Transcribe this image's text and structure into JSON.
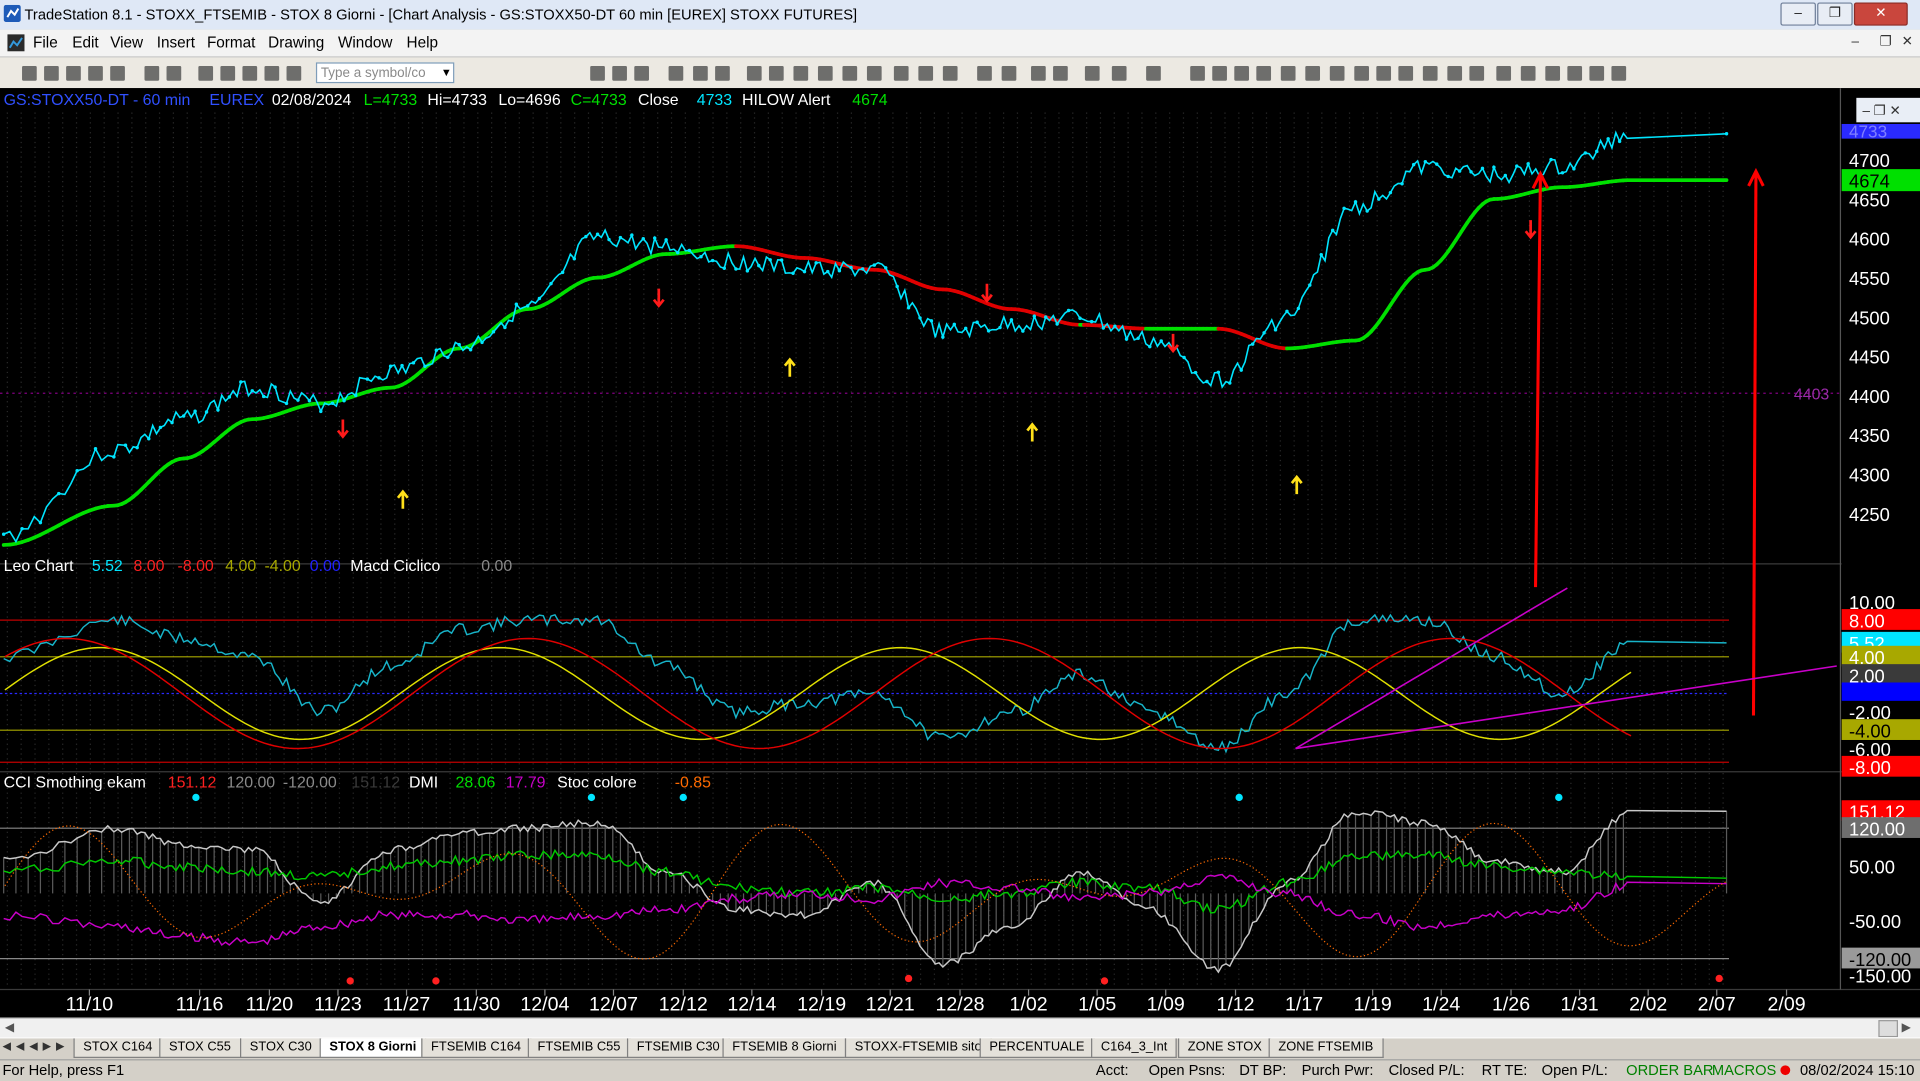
{
  "window": {
    "title": "TradeStation 8.1 - STOXX_FTSEMIB - STOX  8 Giorni - [Chart Analysis - GS:STOXX50-DT  60 min  [EUREX] STOXX FUTURES]"
  },
  "menu": [
    "File",
    "Edit",
    "View",
    "Insert",
    "Format",
    "Drawing",
    "Window",
    "Help"
  ],
  "toolbar": {
    "symbol_placeholder": "Type a symbol/co"
  },
  "price_header": {
    "symbol": "GS:STOXX50-DT - 60 min",
    "exchange": "EUREX",
    "date": "02/08/2024",
    "last": "L=4733",
    "hi": "Hi=4733",
    "lo": "Lo=4696",
    "close_eq": "C=4733",
    "close_label": "Close",
    "close_val": "4733",
    "hilow_label": "HILOW Alert",
    "hilow_val": "4674"
  },
  "leo_header": {
    "title": "Leo Chart",
    "v1": "5.52",
    "v2": "8.00",
    "v3": "-8.00",
    "v4": "4.00",
    "v5": "-4.00",
    "v6": "0.00",
    "macd_label": "Macd Ciclico",
    "macd_val": "0.00"
  },
  "cci_header": {
    "title": "CCI Smothing ekam",
    "v1": "151.12",
    "v2": "120.00",
    "v3": "-120.00",
    "v4": "151.12",
    "dmi_label": "DMI",
    "dmi1": "28.06",
    "dmi2": "17.79",
    "stoc_label": "Stoc colore",
    "stoc_val": "-0.85"
  },
  "axis": {
    "price_ticks": [
      "4700",
      "4650",
      "4600",
      "4550",
      "4500",
      "4450",
      "4400",
      "4350",
      "4300",
      "4250"
    ],
    "price_top_partial": "4733",
    "price_badge": "4674",
    "price_ref_label": "4403",
    "leo_ticks": [
      "10.00",
      "-6.00"
    ],
    "leo_badges": [
      {
        "text": "8.00",
        "bg": "#ff0000",
        "fg": "#ffffff"
      },
      {
        "text": "5.52",
        "bg": "#00e5ff",
        "fg": "#ffffff"
      },
      {
        "text": "4.00",
        "bg": "#a8a800",
        "fg": "#ffffff"
      },
      {
        "text": "2.00",
        "bg": "#3a3a3a",
        "fg": "#ffffff"
      },
      {
        "text": "0.00",
        "bg": "#0000ff",
        "fg": "#0000ff"
      },
      {
        "text": "-2.00",
        "bg": "#000000",
        "fg": "#ffffff"
      },
      {
        "text": "-4.00",
        "bg": "#a8a800",
        "fg": "#000000"
      },
      {
        "text": "-8.00",
        "bg": "#ff0000",
        "fg": "#ffffff"
      }
    ],
    "cci_ticks": [
      "50.00",
      "-50.00",
      "-150.00"
    ],
    "cci_badges": [
      {
        "text": "151.12",
        "bg": "#ff0000",
        "fg": "#ffffff"
      },
      {
        "text": "120.00",
        "bg": "#6e6e6e",
        "fg": "#ffffff"
      },
      {
        "text": "-120.00",
        "bg": "#9a9a9a",
        "fg": "#000000"
      }
    ],
    "dates": [
      "11/10",
      "11/16",
      "11/20",
      "11/23",
      "11/27",
      "11/30",
      "12/04",
      "12/07",
      "12/12",
      "12/14",
      "12/19",
      "12/21",
      "12/28",
      "1/02",
      "1/05",
      "1/09",
      "1/12",
      "1/17",
      "1/19",
      "1/24",
      "1/26",
      "1/31",
      "2/02",
      "2/07",
      "2/09"
    ]
  },
  "tabs": [
    "STOX C164",
    "STOX C55",
    "STOX  C30",
    "STOX  8 Giorni",
    "FTSEMIB C164",
    "FTSEMIB C55",
    "FTSEMIB C30",
    "FTSEMIB  8 Giorni",
    "STOXX-FTSEMIB sito",
    "PERCENTUALE",
    "C164_3_Int",
    "ZONE STOX",
    "ZONE FTSEMIB"
  ],
  "active_tab": "STOX  8 Giorni",
  "status": {
    "help": "For Help, press F1",
    "acct": "Acct:",
    "open_psns": "Open Psns:",
    "dt_bp": "DT BP:",
    "purch_pwr": "Purch Pwr:",
    "closed_pl": "Closed P/L:",
    "rt_te": "RT TE:",
    "open_pl": "Open P/L:",
    "order_bar": "ORDER BAR",
    "macros": "MACROS",
    "datetime": "08/02/2024 15:10"
  },
  "colors": {
    "price_line": "#00e5ff",
    "trend_up": "#00e000",
    "trend_down": "#e00000",
    "leo_fast": "#e0e000",
    "leo_slow": "#e00000",
    "trendline": "#c800c8",
    "dmi_plus": "#00c800",
    "dmi_minus": "#c800c8",
    "stoc": "#ff6a00"
  },
  "chart_data": [
    {
      "type": "line",
      "title": "GS:STOXX50-DT - 60 min",
      "yrange": [
        4200,
        4760
      ],
      "x": [
        "11/10",
        "11/16",
        "11/20",
        "11/23",
        "11/27",
        "11/30",
        "12/04",
        "12/07",
        "12/12",
        "12/14",
        "12/19",
        "12/21",
        "12/28",
        "1/02",
        "1/05",
        "1/09",
        "1/12",
        "1/17",
        "1/19",
        "1/24",
        "1/26",
        "1/31",
        "2/02",
        "2/07"
      ],
      "series": [
        {
          "name": "Close",
          "values": [
            4220,
            4330,
            4370,
            4410,
            4390,
            4430,
            4460,
            4510,
            4600,
            4590,
            4570,
            4560,
            4560,
            4480,
            4490,
            4500,
            4470,
            4420,
            4500,
            4640,
            4690,
            4680,
            4690,
            4733
          ]
        },
        {
          "name": "HILOW Alert",
          "values": [
            4210,
            4260,
            4320,
            4370,
            4390,
            4410,
            4460,
            4510,
            4550,
            4580,
            4590,
            4575,
            4560,
            4535,
            4510,
            4490,
            4485,
            4485,
            4460,
            4470,
            4560,
            4650,
            4665,
            4674
          ]
        }
      ]
    },
    {
      "type": "line",
      "title": "Leo Chart",
      "yrange": [
        -8,
        12
      ],
      "x": [
        "11/10",
        "11/16",
        "11/20",
        "11/23",
        "11/27",
        "11/30",
        "12/04",
        "12/07",
        "12/12",
        "12/14",
        "12/19",
        "12/21",
        "12/28",
        "1/02",
        "1/05",
        "1/09",
        "1/12",
        "1/17",
        "1/19",
        "1/24",
        "1/26",
        "1/31",
        "2/02",
        "2/07"
      ],
      "series": [
        {
          "name": "Macd Ciclico",
          "values": [
            4,
            8,
            6,
            4,
            -2,
            3,
            7,
            8,
            8,
            3,
            -2,
            -1,
            0,
            -5,
            -2,
            2,
            -2,
            -6,
            0,
            8,
            8,
            4,
            0,
            5.52
          ]
        }
      ]
    },
    {
      "type": "line",
      "title": "CCI Smothing ekam",
      "yrange": [
        -170,
        190
      ],
      "x": [
        "11/10",
        "11/16",
        "11/20",
        "11/23",
        "11/27",
        "11/30",
        "12/04",
        "12/07",
        "12/12",
        "12/14",
        "12/19",
        "12/21",
        "12/28",
        "1/02",
        "1/05",
        "1/09",
        "1/12",
        "1/17",
        "1/19",
        "1/24",
        "1/26",
        "1/31",
        "2/02",
        "2/07"
      ],
      "series": [
        {
          "name": "CCI Smothing ekam",
          "values": [
            60,
            120,
            90,
            80,
            -20,
            80,
            110,
            120,
            130,
            40,
            -30,
            -40,
            20,
            -130,
            -60,
            40,
            -30,
            -140,
            20,
            150,
            130,
            60,
            40,
            151.12
          ]
        },
        {
          "name": "DMI+",
          "values": [
            40,
            60,
            50,
            40,
            30,
            50,
            60,
            70,
            70,
            40,
            10,
            0,
            10,
            -10,
            0,
            20,
            10,
            -30,
            20,
            70,
            70,
            50,
            40,
            28.06
          ]
        },
        {
          "name": "DMI-",
          "values": [
            -40,
            -60,
            -80,
            -90,
            -60,
            -40,
            -40,
            -50,
            -40,
            -30,
            -10,
            0,
            -10,
            20,
            10,
            -10,
            0,
            30,
            0,
            -40,
            -60,
            -40,
            -30,
            17.79
          ]
        }
      ]
    }
  ]
}
